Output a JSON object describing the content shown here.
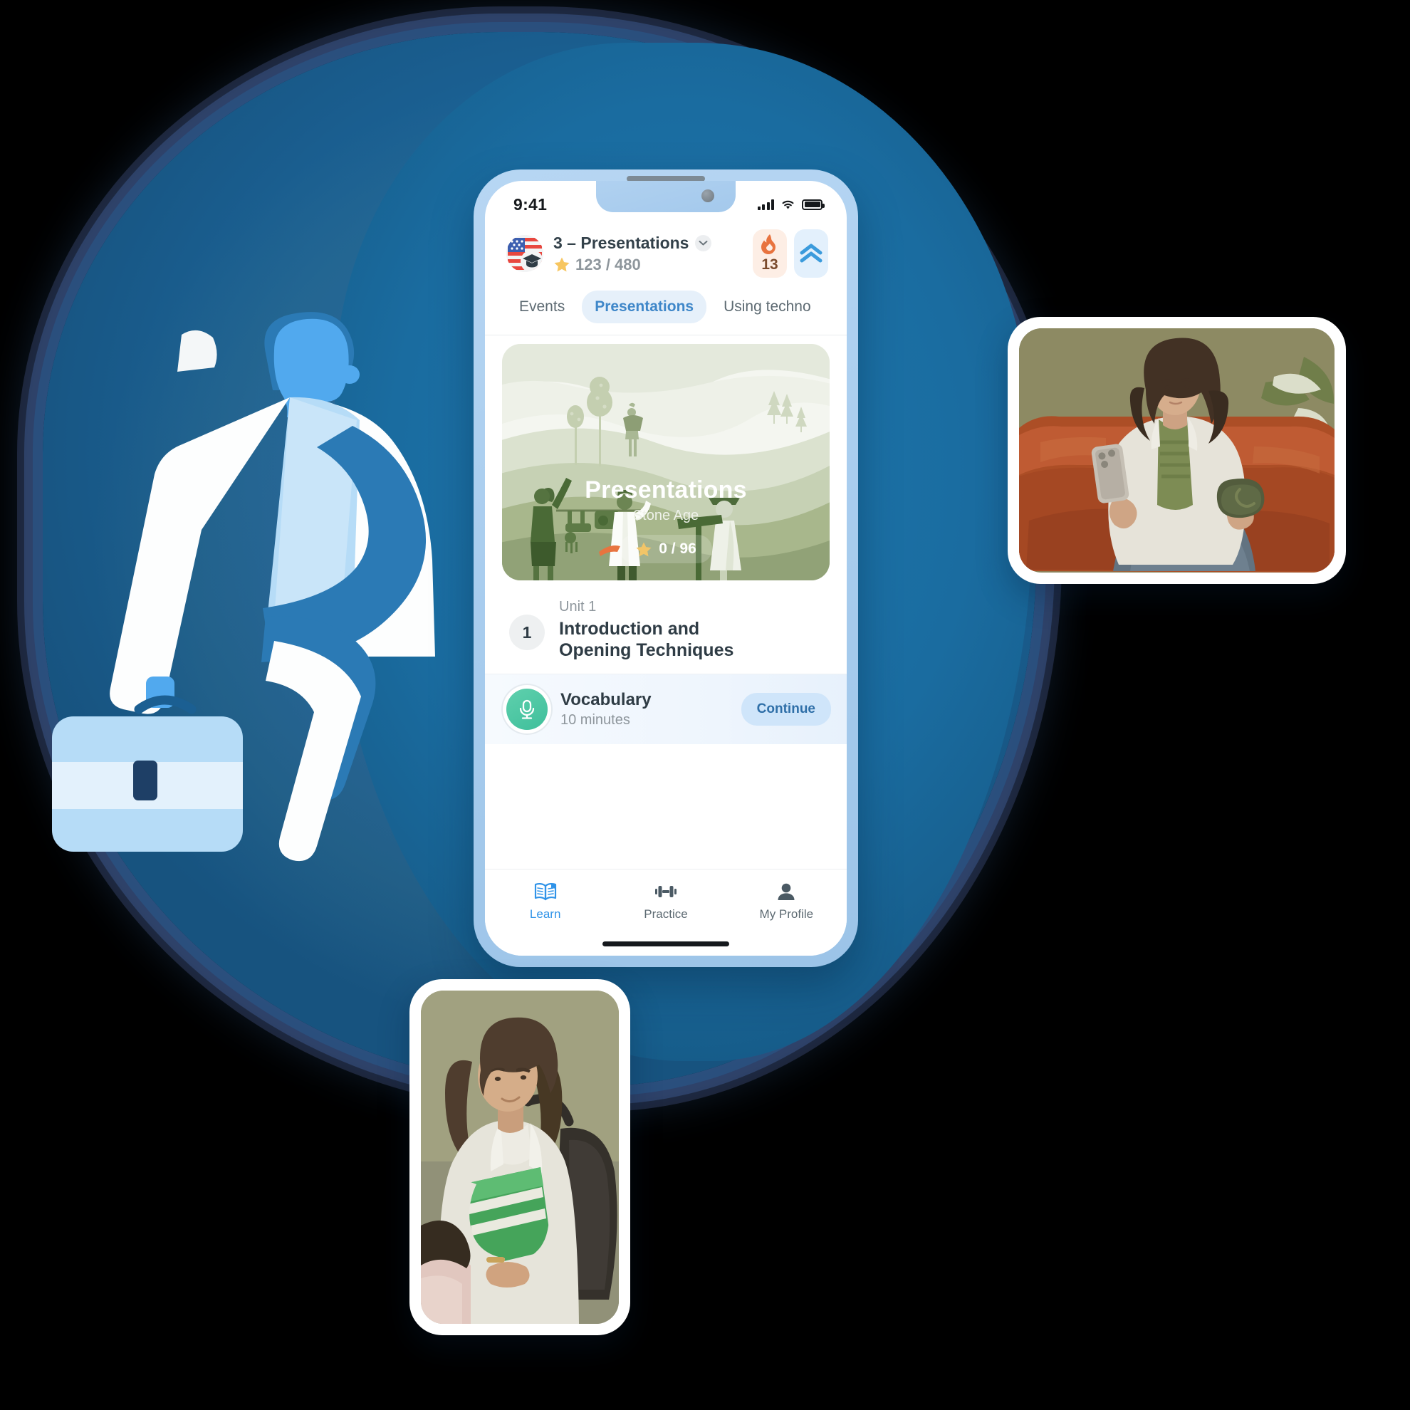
{
  "brand": {
    "accent_blue": "#2f93e8",
    "tab_active_bg": "#e6f0fa",
    "streak_bg": "#fdeee5",
    "level_bg": "#e3f0fc",
    "hero_green": "#788a5e",
    "lesson_teal": "#3fbf9b",
    "continue_bg": "#cfe5fa",
    "backdrop_blue": "#1a6ca0"
  },
  "status_bar": {
    "time": "9:41",
    "signal_icon": "cellular-bars-icon",
    "wifi_icon": "wifi-icon",
    "battery_icon": "battery-icon"
  },
  "header": {
    "avatar_icon": "us-flag-graduation-cap-avatar",
    "title": "3 – Presentations",
    "chevron_icon": "chevron-down-icon",
    "star_icon": "star-icon",
    "points": "123 / 480",
    "streak": {
      "icon": "flame-icon",
      "value": "13"
    },
    "level": {
      "icon": "double-chevron-up-icon"
    }
  },
  "tabs": [
    {
      "label": "Events",
      "active": false
    },
    {
      "label": "Presentations",
      "active": true
    },
    {
      "label": "Using techno",
      "active": false
    }
  ],
  "hero": {
    "illustration": "stone-age-presentation-scene",
    "title": "Presentations",
    "subtitle": "Stone Age",
    "star_icon": "star-icon",
    "progress": "0 / 96"
  },
  "unit": {
    "number": "1",
    "label": "Unit 1",
    "title": "Introduction and\nOpening Techniques",
    "title_line1": "Introduction and",
    "title_line2": "Opening Techniques"
  },
  "lesson": {
    "icon": "microphone-icon",
    "title": "Vocabulary",
    "duration": "10 minutes",
    "cta": "Continue"
  },
  "bottom_nav": [
    {
      "label": "Learn",
      "icon": "open-book-icon",
      "active": true
    },
    {
      "label": "Practice",
      "icon": "dumbbell-icon",
      "active": false
    },
    {
      "label": "My Profile",
      "icon": "person-icon",
      "active": false
    }
  ],
  "decorations": {
    "left_illustration": "man-with-briefcase-illustration",
    "photo_top_right": "woman-on-sofa-with-phone-and-mug-photo",
    "photo_bottom_left": "student-with-notebook-and-backpack-photo"
  }
}
